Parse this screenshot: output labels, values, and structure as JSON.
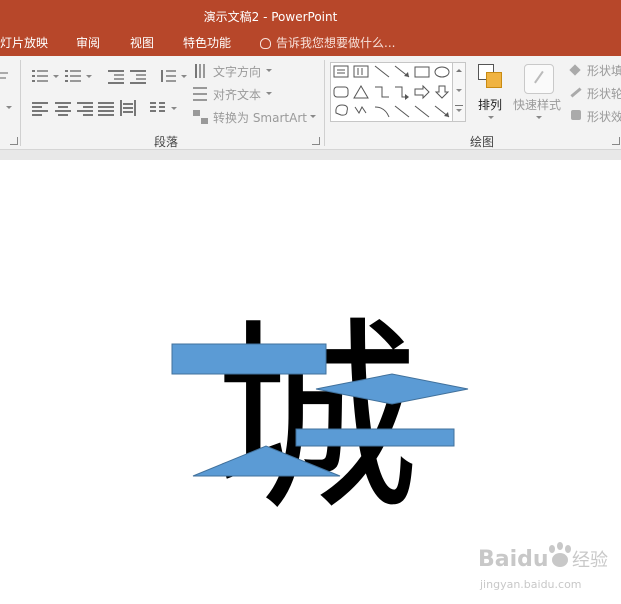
{
  "window": {
    "title": "演示文稿2 - PowerPoint"
  },
  "tabs": [
    {
      "label": "灯片放映"
    },
    {
      "label": "审阅"
    },
    {
      "label": "视图"
    },
    {
      "label": "特色功能"
    }
  ],
  "tell_me": {
    "placeholder": "告诉我您想要做什么..."
  },
  "ribbon": {
    "paragraph": {
      "label": "段落",
      "text_direction": "文字方向",
      "align_text": "对齐文本",
      "convert_smartart": "转换为 SmartArt"
    },
    "drawing": {
      "label": "绘图",
      "arrange": "排列",
      "quick_styles": "快速样式",
      "shape_fill": "形状填",
      "shape_outline": "形状轮",
      "shape_effects": "形状效"
    }
  },
  "slide": {
    "glyph": "城"
  },
  "watermark": {
    "brand": "Baidu",
    "cn": "经验",
    "url": "jingyan.baidu.com"
  },
  "colors": {
    "title_bar": "#b7472a",
    "ribbon_bg": "#f3f3f3",
    "shape_fill": "#5b9bd5",
    "shape_stroke": "#41719c",
    "glyph": "#000000"
  }
}
